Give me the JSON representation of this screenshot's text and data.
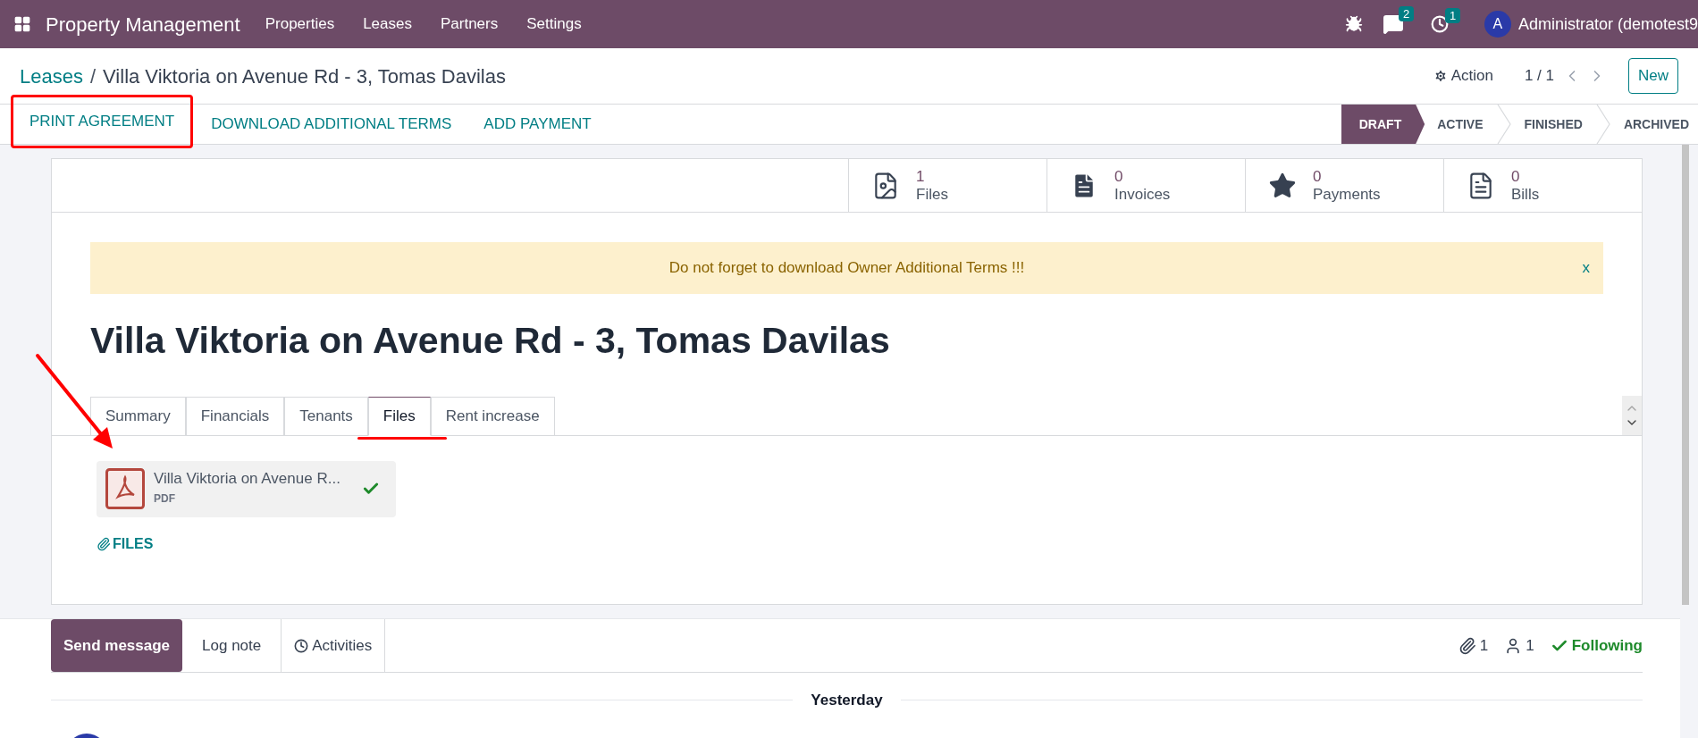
{
  "navbar": {
    "app_name": "Property Management",
    "menu": [
      "Properties",
      "Leases",
      "Partners",
      "Settings"
    ],
    "messages_count": "2",
    "activities_count": "1",
    "avatar_letter": "A",
    "user": "Administrator (demotest9"
  },
  "breadcrumb": {
    "parent": "Leases",
    "separator": "/",
    "current": "Villa Viktoria on Avenue Rd - 3, Tomas Davilas"
  },
  "pager": {
    "action": "Action",
    "position": "1 / 1",
    "new_button": "New"
  },
  "header_buttons": [
    {
      "label": "PRINT AGREEMENT",
      "highlighted": true
    },
    {
      "label": "DOWNLOAD ADDITIONAL TERMS",
      "highlighted": false
    },
    {
      "label": "ADD PAYMENT",
      "highlighted": false
    }
  ],
  "stages": [
    {
      "label": "DRAFT",
      "selected": true
    },
    {
      "label": "ACTIVE",
      "selected": false
    },
    {
      "label": "FINISHED",
      "selected": false
    },
    {
      "label": "ARCHIVED",
      "selected": false
    }
  ],
  "stat_buttons": [
    {
      "kind": "image",
      "value": "1",
      "label": "Files"
    },
    {
      "kind": "document",
      "value": "0",
      "label": "Invoices"
    },
    {
      "kind": "star",
      "value": "0",
      "label": "Payments"
    },
    {
      "kind": "lines",
      "value": "0",
      "label": "Bills"
    }
  ],
  "alert": {
    "text": "Do not forget to download Owner Additional Terms !!!",
    "close": "x"
  },
  "title": "Villa Viktoria on Avenue Rd - 3, Tomas Davilas",
  "tabs": [
    {
      "label": "Summary",
      "selected": false
    },
    {
      "label": "Financials",
      "selected": false
    },
    {
      "label": "Tenants",
      "selected": false
    },
    {
      "label": "Files",
      "selected": true,
      "highlighted": true
    },
    {
      "label": "Rent increase",
      "selected": false
    }
  ],
  "attachment": {
    "name": "Villa Viktoria on Avenue R...",
    "type": "PDF",
    "uploaded": true
  },
  "files_button": "FILES",
  "chatter": {
    "tabs": [
      {
        "label": "Send message",
        "selected": true
      },
      {
        "label": "Log note",
        "selected": false
      },
      {
        "label": "Activities",
        "selected": false
      }
    ],
    "attachments_count": "1",
    "followers_count": "1",
    "following": "Following",
    "date_separator": "Yesterday"
  }
}
